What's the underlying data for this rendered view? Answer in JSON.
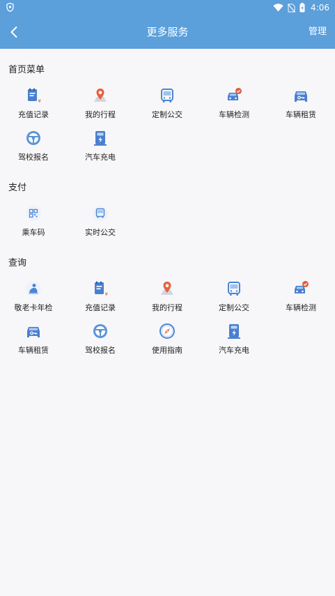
{
  "status": {
    "time": "4:06"
  },
  "appbar": {
    "title": "更多服务",
    "manage": "管理"
  },
  "sections": [
    {
      "title": "首页菜单",
      "items": [
        {
          "label": "充值记录",
          "icon": "recharge-record-icon"
        },
        {
          "label": "我的行程",
          "icon": "map-pin-icon"
        },
        {
          "label": "定制公交",
          "icon": "bus-icon"
        },
        {
          "label": "车辆检测",
          "icon": "car-check-icon"
        },
        {
          "label": "车辆租赁",
          "icon": "car-rental-icon"
        },
        {
          "label": "驾校报名",
          "icon": "steering-wheel-icon"
        },
        {
          "label": "汽车充电",
          "icon": "charging-station-icon"
        }
      ]
    },
    {
      "title": "支付",
      "items": [
        {
          "label": "乘车码",
          "icon": "qr-code-icon"
        },
        {
          "label": "实时公交",
          "icon": "bus-icon"
        }
      ]
    },
    {
      "title": "查询",
      "items": [
        {
          "label": "敬老卡年检",
          "icon": "elder-card-icon"
        },
        {
          "label": "充值记录",
          "icon": "recharge-record-icon"
        },
        {
          "label": "我的行程",
          "icon": "map-pin-icon"
        },
        {
          "label": "定制公交",
          "icon": "bus-icon"
        },
        {
          "label": "车辆检测",
          "icon": "car-check-icon"
        },
        {
          "label": "车辆租赁",
          "icon": "car-rental-icon"
        },
        {
          "label": "驾校报名",
          "icon": "steering-wheel-icon"
        },
        {
          "label": "使用指南",
          "icon": "compass-icon"
        },
        {
          "label": "汽车充电",
          "icon": "charging-station-icon"
        }
      ]
    }
  ],
  "colors": {
    "primary": "#5b9fdb",
    "accent": "#e05a3a",
    "icon": "#4a86d4"
  }
}
